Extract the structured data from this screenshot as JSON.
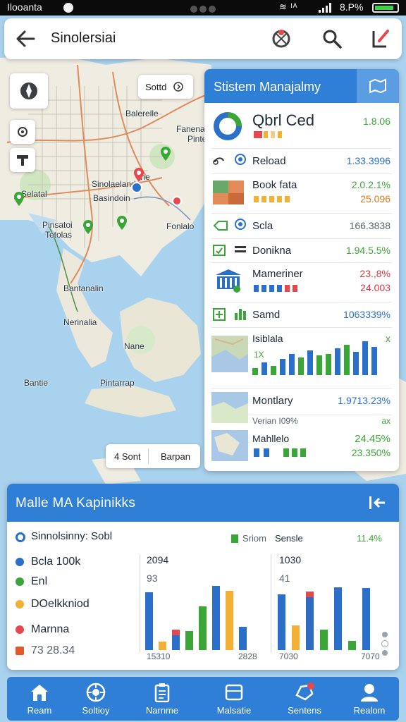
{
  "status_bar": {
    "carrier": "Ilooanta",
    "icons_text": "≋ ᴵᴬ",
    "battery_text": "8.P%"
  },
  "top_bar": {
    "title": "Sinolersiai",
    "icons": [
      "back-arrow-icon",
      "globe-pin-icon",
      "search-icon",
      "edit-pen-icon"
    ]
  },
  "map": {
    "labels": {
      "fanena": "Fanena",
      "pintens": "Pintens",
      "balerelle": "Balerelle",
      "ine": "Ine",
      "sinolaeland": "Sinolaeland",
      "basindoin": "Basindoin",
      "selatal": "Selatal",
      "pinsatoi": "Pinsatoi",
      "tetolas": "Tetolas",
      "fonlalo": "Fonlalo",
      "bantanalin": "Bantanalin",
      "nerinalia": "Nerinalia",
      "nane": "Nane",
      "bantie": "Bantie",
      "pintarrap": "Pintarrap"
    },
    "chip_top": "Sottd",
    "chip_bottom": {
      "left": "4 Sont",
      "right": "Barpan"
    }
  },
  "side_panel": {
    "title": "Stistem Manajalmy",
    "rows": [
      {
        "name": "Qbrl Ced",
        "value": "1.8.06"
      },
      {
        "name": "Reload",
        "value": "1.33.3996"
      },
      {
        "name": "Book fata",
        "value": "2.0.2.1%",
        "value2": "25.096"
      },
      {
        "name": "Scla",
        "value": "166.3838"
      },
      {
        "name": "Donikna",
        "value": "1.94.5.5%"
      },
      {
        "name": "Mameriner",
        "value": "23.,8%",
        "value2": "24.003"
      },
      {
        "name": "Samd",
        "value": "1063339%"
      },
      {
        "name": "Isiblala",
        "value": "x"
      },
      {
        "name": "Montlary",
        "value": "1.9713.23%"
      },
      {
        "name": "Verian I09%",
        "value": "ax"
      },
      {
        "name": "Mahllelo",
        "value": "24.45%",
        "value2": "23.350%"
      }
    ],
    "mini_chart_bars": [
      0.2,
      0.35,
      0.25,
      0.45,
      0.6,
      0.5,
      0.7,
      0.55,
      0.6,
      0.75,
      0.85,
      0.65,
      0.95,
      0.8
    ],
    "bar_colors": [
      "#3aa637",
      "#2a6fc9"
    ],
    "x_marker": "1X"
  },
  "bottom_panel": {
    "title": "Malle MA Kapinikks",
    "legend": [
      {
        "label": "Sinnolsinny: Sobl",
        "color": "#2a6fc9",
        "style": "ring"
      },
      {
        "label": "Bcla 100k",
        "color": "#2a6fc9"
      },
      {
        "label": "Enl",
        "color": "#3aa637"
      },
      {
        "label": "DOelkkniod",
        "color": "#f2b134"
      },
      {
        "label": "Marnna",
        "color": "#e5484d"
      },
      {
        "label": "73 28.34",
        "color": "#e5484d",
        "style": "square"
      }
    ],
    "header_labels": {
      "sriom": "Sriom",
      "sensle": "Sensle",
      "pct": "11.4%"
    },
    "chart_left": {
      "top_label": "2094",
      "sub_label": "93",
      "x_start": "15310",
      "x_end": "2828",
      "values": [
        0.85,
        0.12,
        0.3,
        0.28,
        0.65,
        0.95,
        0.88,
        0.34
      ]
    },
    "chart_right": {
      "top_label": "1030",
      "sub_label": "41",
      "x_start": "7030",
      "x_end": "7070",
      "values": [
        0.82,
        0.36,
        0.86,
        0.3,
        0.93,
        0.14,
        0.92
      ]
    }
  },
  "nav": [
    {
      "label": "Ream",
      "icon": "home-icon"
    },
    {
      "label": "Soltioy",
      "icon": "target-icon"
    },
    {
      "label": "Narnme",
      "icon": "clipboard-icon"
    },
    {
      "label": "Malsatie",
      "icon": "folder-icon"
    },
    {
      "label": "Sentens",
      "icon": "notification-icon"
    },
    {
      "label": "Realom",
      "icon": "user-icon"
    }
  ]
}
